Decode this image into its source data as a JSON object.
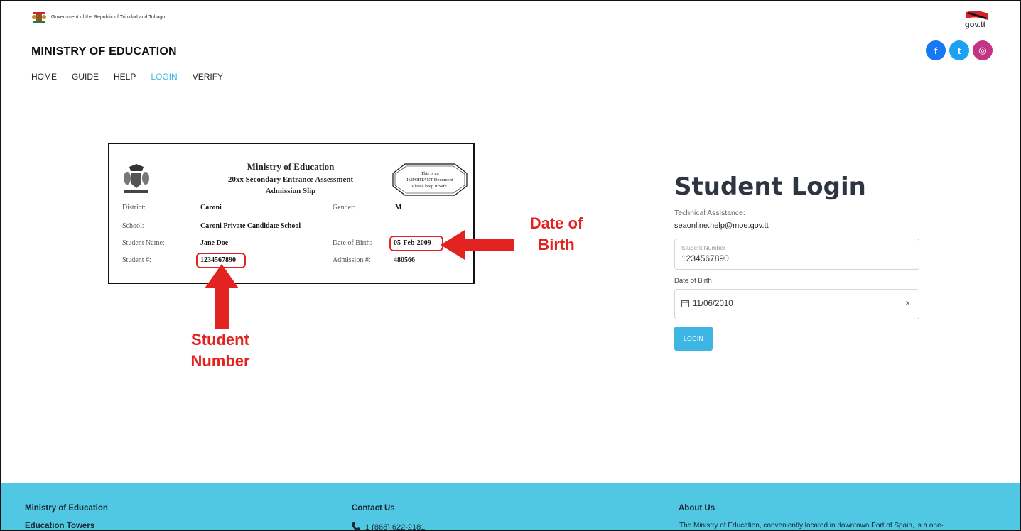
{
  "header": {
    "gov_text": "Government of the Republic of Trinidad and Tobago",
    "gov_logo_text": "gov.tt",
    "ministry_title": "MINISTRY OF EDUCATION"
  },
  "nav": {
    "items": [
      {
        "label": "HOME",
        "active": false
      },
      {
        "label": "GUIDE",
        "active": false
      },
      {
        "label": "HELP",
        "active": false
      },
      {
        "label": "LOGIN",
        "active": true
      },
      {
        "label": "VERIFY",
        "active": false
      }
    ]
  },
  "social": {
    "facebook_glyph": "f",
    "twitter_glyph": "t",
    "instagram_glyph": "◎"
  },
  "slip": {
    "title": "Ministry of Education",
    "subtitle": "20xx Secondary Entrance Assessment",
    "doc_name": "Admission Slip",
    "stamp": [
      "This is an",
      "IMPORTANT Document",
      "Please keep it Safe."
    ],
    "district_label": "District:",
    "district_value": "Caroni",
    "gender_label": "Gender:",
    "gender_value": "M",
    "school_label": "School:",
    "school_value": "Caroni Private Candidate School",
    "name_label": "Student Name:",
    "name_value": "Jane Doe",
    "dob_label": "Date of Birth:",
    "dob_value": "05-Feb-2009",
    "student_no_label": "Student #:",
    "student_no_value": "1234567890",
    "admission_label": "Admission #:",
    "admission_value": "480566"
  },
  "annotations": {
    "dob": [
      "Date of",
      "Birth"
    ],
    "student_number": [
      "Student",
      "Number"
    ],
    "color": "#e32222"
  },
  "login": {
    "title": "Student Login",
    "tech_label": "Technical Assistance:",
    "tech_email": "seaonline.help@moe.gov.tt",
    "student_number_label": "Student Number",
    "student_number_value": "1234567890",
    "dob_label": "Date of Birth",
    "dob_value": "11/06/2010",
    "clear_glyph": "×",
    "button_label": "LOGIN",
    "accent": "#3eb6e4"
  },
  "footer": {
    "col1_title": "Ministry of Education",
    "col1_sub": "Education Towers",
    "col2_title": "Contact Us",
    "phone": "1 (868) 622-2181",
    "col3_title": "About Us",
    "about_text": "The Ministry of Education, conveniently located in downtown Port of Spain, is a one-",
    "background": "#50c8e3"
  }
}
